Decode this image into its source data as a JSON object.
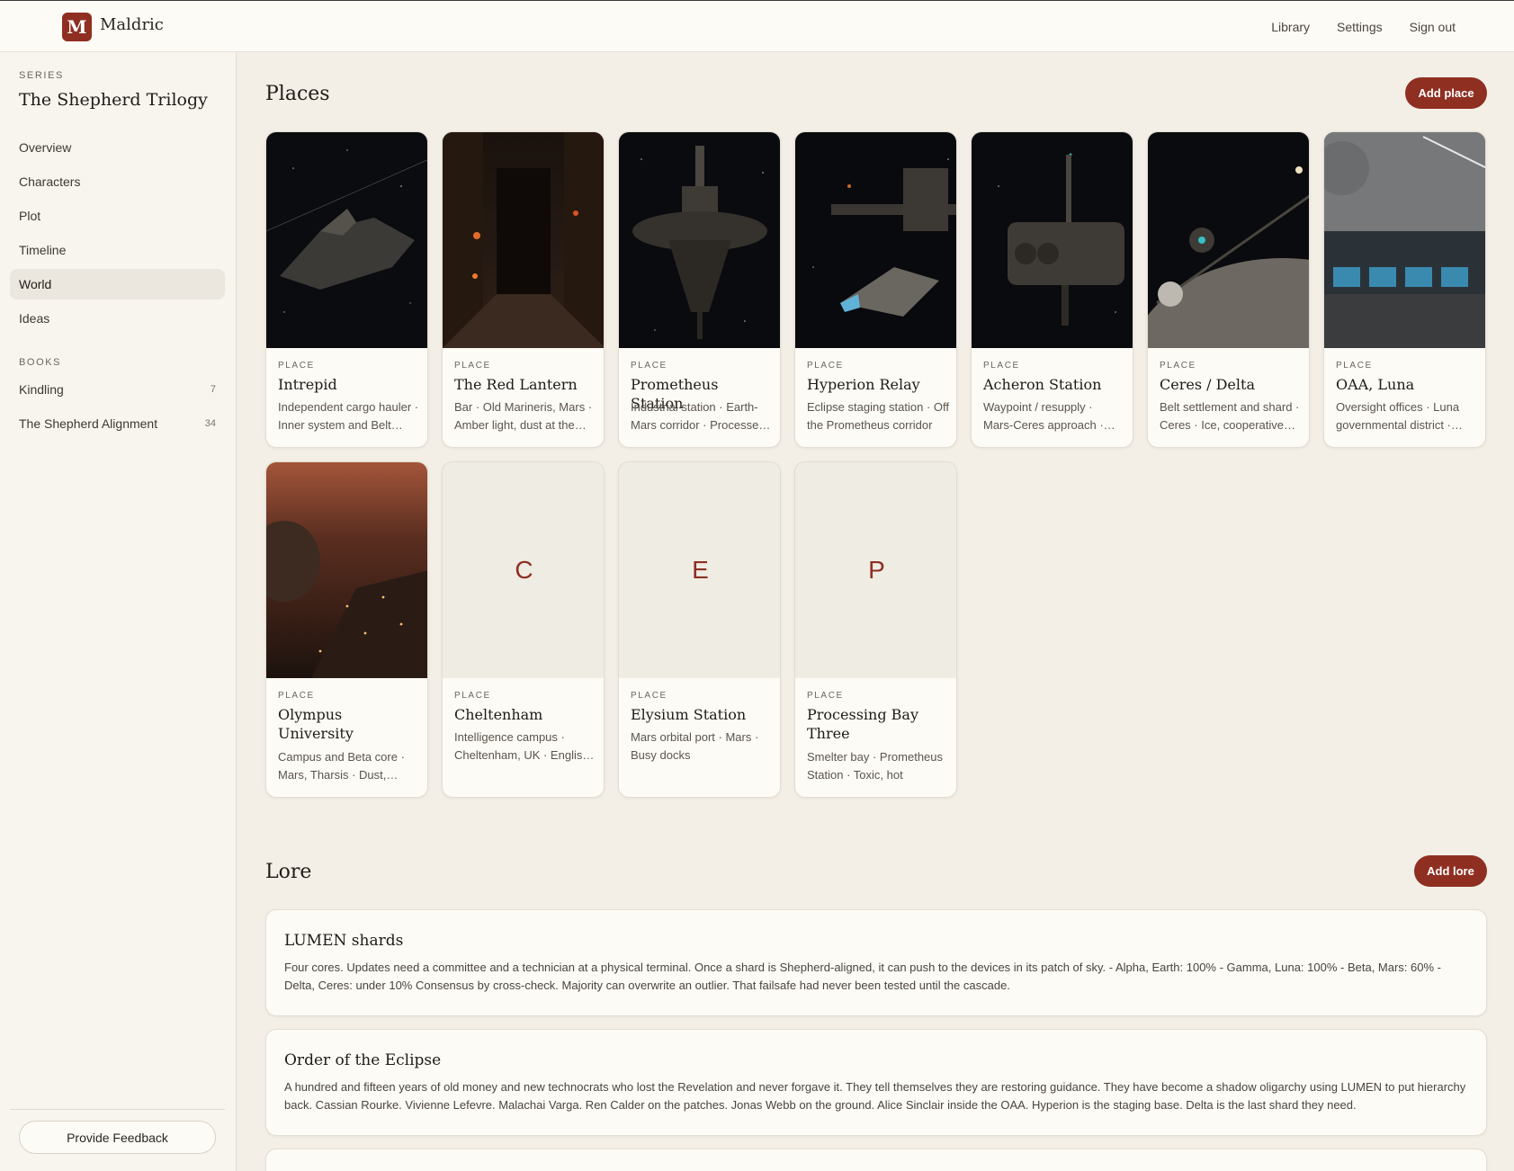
{
  "app": {
    "logo_letter": "M",
    "name": "Maldric"
  },
  "topnav": [
    {
      "label": "Library"
    },
    {
      "label": "Settings"
    },
    {
      "label": "Sign out"
    }
  ],
  "sidebar": {
    "series_label": "SERIES",
    "series_title": "The Shepherd Trilogy",
    "items": [
      {
        "label": "Overview"
      },
      {
        "label": "Characters"
      },
      {
        "label": "Plot"
      },
      {
        "label": "Timeline"
      },
      {
        "label": "World",
        "active": true
      },
      {
        "label": "Ideas"
      }
    ],
    "books_label": "BOOKS",
    "books": [
      {
        "label": "Kindling",
        "count": "7"
      },
      {
        "label": "The Shepherd Alignment",
        "count": "34"
      }
    ],
    "feedback_label": "Provide Feedback"
  },
  "places": {
    "title": "Places",
    "add_label": "Add place",
    "kind_label": "PLACE",
    "cards": [
      {
        "name": "Intrepid",
        "desc": "Independent cargo hauler · Inner system and Belt routes",
        "image": "starship-in-space"
      },
      {
        "name": "The Red Lantern",
        "desc": "Bar · Old Marineris, Mars · Amber light, dust at the door",
        "image": "dark-bar-interior"
      },
      {
        "name": "Prometheus Station",
        "desc": "Industrial station · Earth-Mars corridor · Processed ore",
        "image": "space-station"
      },
      {
        "name": "Hyperion Relay",
        "desc": "Eclipse staging station · Off the Prometheus corridor",
        "image": "relay-station"
      },
      {
        "name": "Acheron Station",
        "desc": "Waypoint / resupply · Mars-Ceres approach · Quiet",
        "image": "station-waypoint"
      },
      {
        "name": "Ceres / Delta",
        "desc": "Belt settlement and shard · Ceres · Ice, cooperative spirit",
        "image": "asteroid-settlement"
      },
      {
        "name": "OAA, Luna",
        "desc": "Oversight offices · Luna governmental district · Clean lines",
        "image": "office-interior"
      },
      {
        "name": "Olympus University",
        "desc": "Campus and Beta core · Mars, Tharsis · Dust, domes",
        "image": "mars-city"
      },
      {
        "name": "Cheltenham",
        "desc": "Intelligence campus · Cheltenham, UK · English rain",
        "image": "",
        "initial": "C"
      },
      {
        "name": "Elysium Station",
        "desc": "Mars orbital port · Mars · Busy docks",
        "image": "",
        "initial": "E"
      },
      {
        "name": "Processing Bay Three",
        "desc": "Smelter bay · Prometheus Station · Toxic, hot",
        "image": "",
        "initial": "P"
      }
    ]
  },
  "lore": {
    "title": "Lore",
    "add_label": "Add lore",
    "entries": [
      {
        "title": "LUMEN shards",
        "body": "Four cores. Updates need a committee and a technician at a physical terminal. Once a shard is Shepherd-aligned, it can push to the devices in its patch of sky. - Alpha, Earth: 100% - Gamma, Luna: 100% - Beta, Mars: 60% - Delta, Ceres: under 10% Consensus by cross-check. Majority can overwrite an outlier. That failsafe had never been tested until the cascade."
      },
      {
        "title": "Order of the Eclipse",
        "body": "A hundred and fifteen years of old money and new technocrats who lost the Revelation and never forgave it. They tell themselves they are restoring guidance. They have become a shadow oligarchy using LUMEN to put hierarchy back. Cassian Rourke. Vivienne Lefevre. Malachai Varga. Ren Calder on the patches. Jonas Webb on the ground. Alice Sinclair inside the OAA. Hyperion is the staging base. Delta is the last shard they need."
      }
    ]
  },
  "colors": {
    "accent": "#8e2f22",
    "background": "#f3efe7",
    "card": "#fdfbf6"
  }
}
